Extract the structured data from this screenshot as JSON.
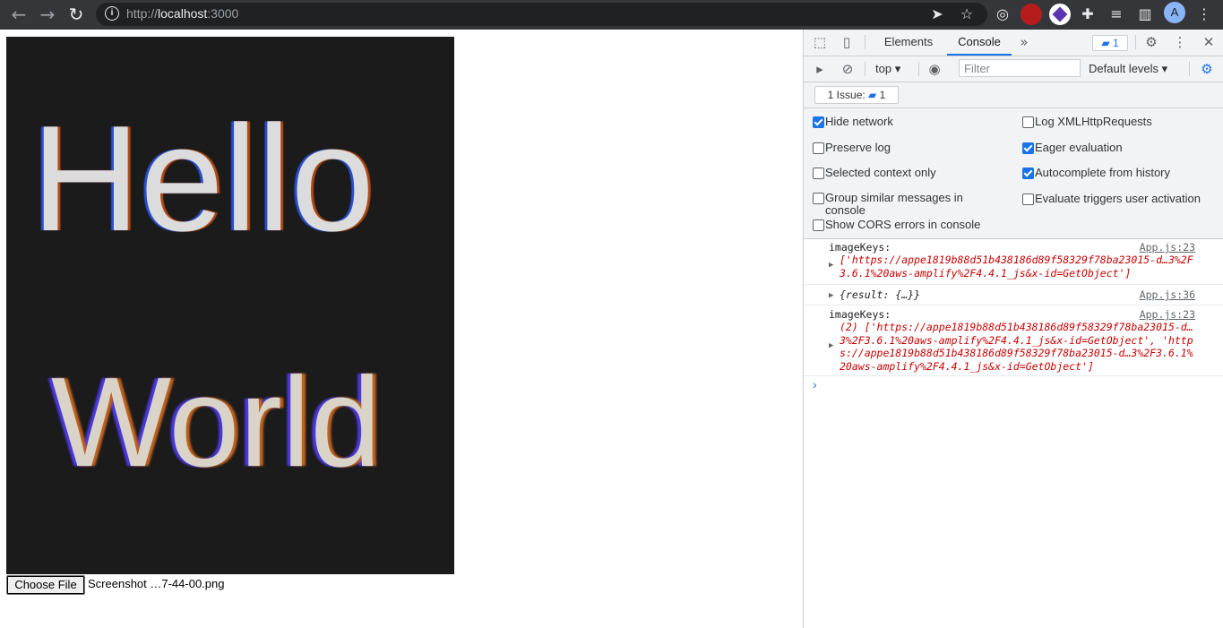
{
  "browser": {
    "url_scheme": "http://",
    "url_host": "localhost",
    "url_port": ":3000",
    "profile_initial": "A"
  },
  "page": {
    "image_text_line1": "Hello",
    "image_text_line2": "World",
    "choose_file_label": "Choose File",
    "file_name": "Screenshot …7-44-00.png"
  },
  "devtools": {
    "tabs": {
      "elements": "Elements",
      "console": "Console"
    },
    "issues_badge_count": "1",
    "toolbar": {
      "context": "top",
      "filter_placeholder": "Filter",
      "levels": "Default levels"
    },
    "issues_bar": {
      "label": "1 Issue:",
      "count": "1"
    },
    "settings": {
      "hide_network": "Hide network",
      "preserve_log": "Preserve log",
      "selected_context": "Selected context only",
      "group_similar": "Group similar messages in console",
      "show_cors": "Show CORS errors in console",
      "log_xhr": "Log XMLHttpRequests",
      "eager_eval": "Eager evaluation",
      "autocomplete": "Autocomplete from history",
      "evaluate_triggers": "Evaluate triggers user activation"
    },
    "messages": [
      {
        "label": "imageKeys:",
        "source": "App.js:23",
        "value": "['https://appe1819b88d51b438186d89f58329f78ba23015-d…3%2F3.6.1%20aws-amplify%2F4.4.1_js&x-id=GetObject']"
      },
      {
        "label": "",
        "source": "App.js:36",
        "value": "{result: {…}}"
      },
      {
        "label": "imageKeys:",
        "source": "App.js:23",
        "value": "(2) ['https://appe1819b88d51b438186d89f58329f78ba23015-d…3%2F3.6.1%20aws-amplify%2F4.4.1_js&x-id=GetObject', 'https://appe1819b88d51b438186d89f58329f78ba23015-d…3%2F3.6.1%20aws-amplify%2F4.4.1_js&x-id=GetObject']"
      }
    ],
    "prompt": "›"
  }
}
